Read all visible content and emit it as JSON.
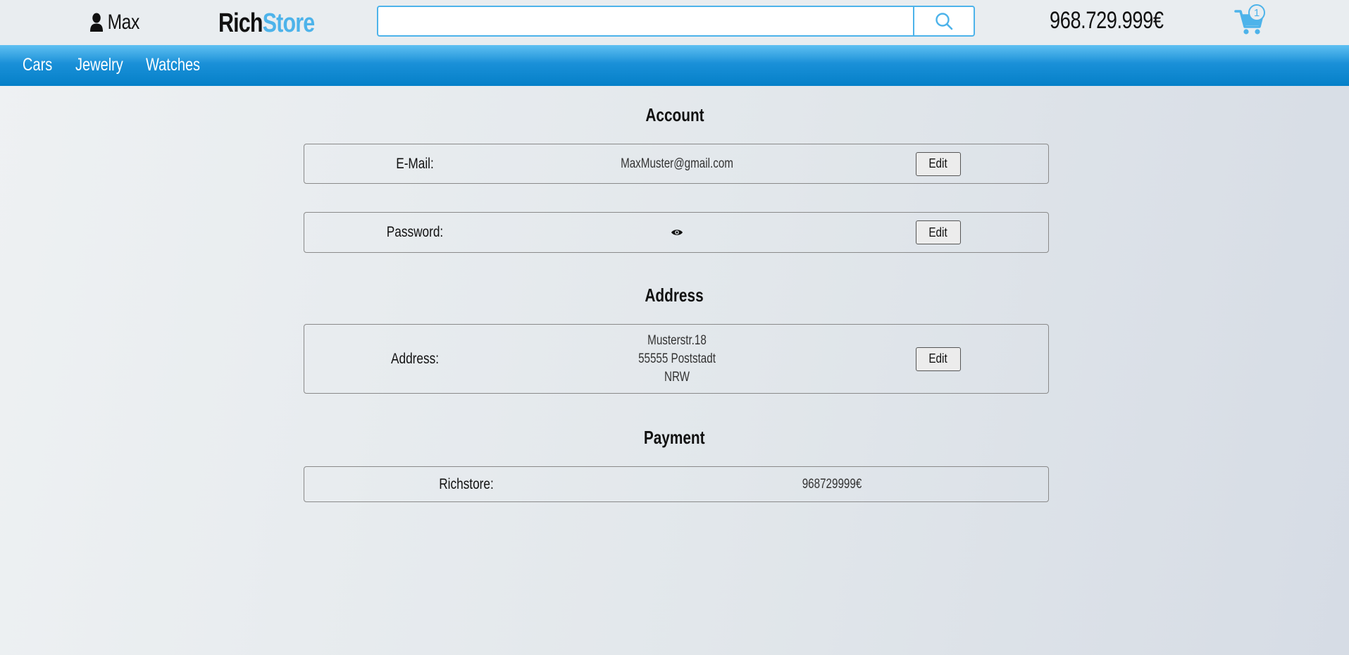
{
  "header": {
    "username": "Max",
    "user_icon": "user-icon",
    "logo_part1": "Rich",
    "logo_part2": "Store",
    "search_value": "",
    "search_placeholder": "",
    "search_icon": "search-icon",
    "balance": "968.729.999€",
    "cart_icon": "cart-icon",
    "cart_count": "1"
  },
  "nav": {
    "items": [
      {
        "label": "Cars"
      },
      {
        "label": "Jewelry"
      },
      {
        "label": "Watches"
      }
    ]
  },
  "account": {
    "title": "Account",
    "email_label": "E-Mail:",
    "email_value": "MaxMuster@gmail.com",
    "email_edit": "Edit",
    "password_label": "Password:",
    "password_icon": "eye-icon",
    "password_edit": "Edit"
  },
  "address": {
    "title": "Address",
    "label": "Address:",
    "line1": "Musterstr.18",
    "line2": "55555 Poststadt",
    "line3": "NRW",
    "edit": "Edit"
  },
  "payment": {
    "title": "Payment",
    "label": "Richstore:",
    "value": "968729999€"
  },
  "colors": {
    "accent": "#4db3ea",
    "nav_blue": "#0580c8",
    "background": "#e6eaee"
  }
}
